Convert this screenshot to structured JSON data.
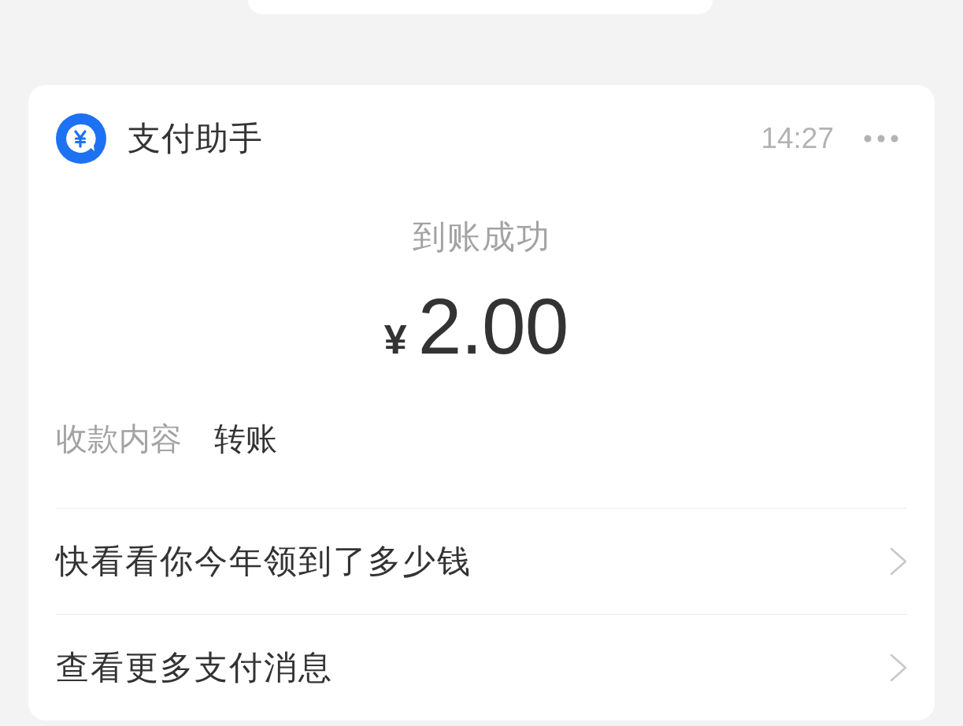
{
  "message": {
    "sender": "支付助手",
    "time": "14:27",
    "status": "到账成功",
    "currency": "¥",
    "amount": "2.00",
    "details": [
      {
        "label": "收款内容",
        "value": "转账"
      }
    ],
    "links": [
      {
        "label": "快看看你今年领到了多少钱"
      },
      {
        "label": "查看更多支付消息"
      }
    ]
  }
}
